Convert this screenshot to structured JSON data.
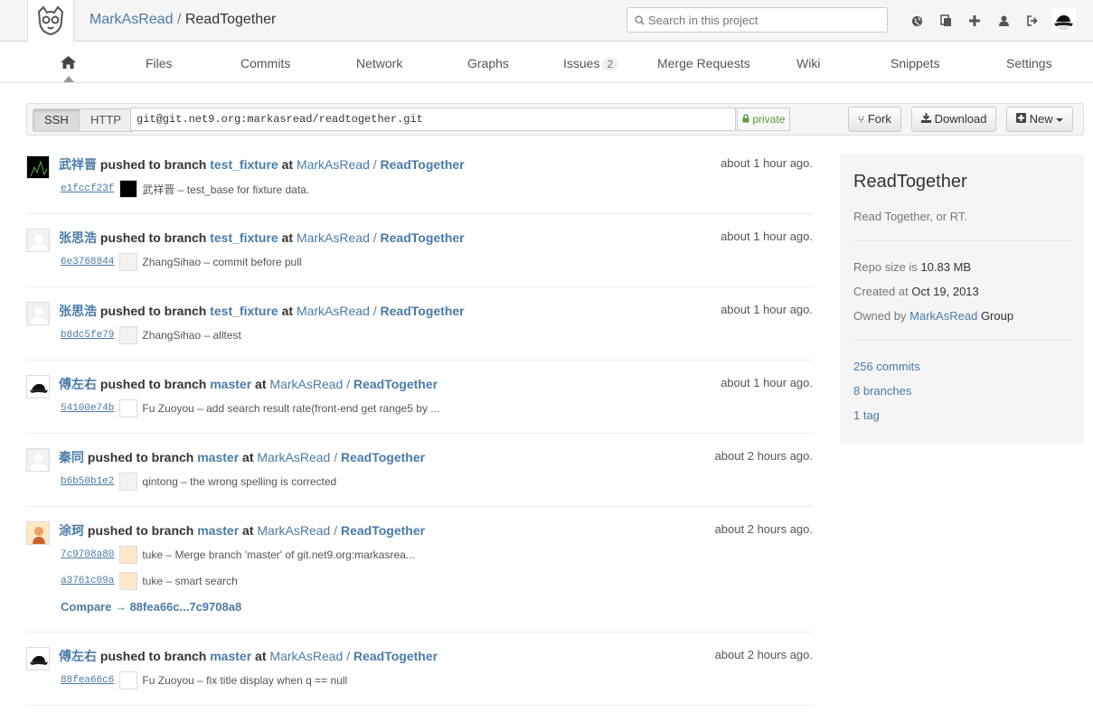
{
  "header": {
    "namespace": "MarkAsRead",
    "separator": "/",
    "project": "ReadTogether",
    "search_placeholder": "Search in this project"
  },
  "nav": {
    "tabs": [
      {
        "label": "Files"
      },
      {
        "label": "Commits"
      },
      {
        "label": "Network"
      },
      {
        "label": "Graphs"
      },
      {
        "label": "Issues",
        "count": "2"
      },
      {
        "label": "Merge Requests"
      },
      {
        "label": "Wiki"
      },
      {
        "label": "Snippets"
      },
      {
        "label": "Settings"
      }
    ]
  },
  "clone": {
    "ssh_label": "SSH",
    "http_label": "HTTP",
    "url": "git@git.net9.org:markasread/readtogether.git",
    "visibility": "private",
    "fork_label": "Fork",
    "download_label": "Download",
    "new_label": "New"
  },
  "events": [
    {
      "user": "武祥晋",
      "action": "pushed to branch",
      "branch": "test_fixture",
      "at": "at",
      "namespace": "MarkAsRead",
      "project": "ReadTogether",
      "time": "about 1 hour ago.",
      "commits": [
        {
          "sha": "e1fccf23f",
          "message": "武祥晋 – test_base for fixture data."
        }
      ]
    },
    {
      "user": "张思浩",
      "action": "pushed to branch",
      "branch": "test_fixture",
      "at": "at",
      "namespace": "MarkAsRead",
      "project": "ReadTogether",
      "time": "about 1 hour ago.",
      "commits": [
        {
          "sha": "6e3768844",
          "message": "ZhangSihao – commit before pull"
        }
      ]
    },
    {
      "user": "张思浩",
      "action": "pushed to branch",
      "branch": "test_fixture",
      "at": "at",
      "namespace": "MarkAsRead",
      "project": "ReadTogether",
      "time": "about 1 hour ago.",
      "commits": [
        {
          "sha": "b8dc5fe79",
          "message": "ZhangSihao – alltest"
        }
      ]
    },
    {
      "user": "傅左右",
      "action": "pushed to branch",
      "branch": "master",
      "at": "at",
      "namespace": "MarkAsRead",
      "project": "ReadTogether",
      "time": "about 1 hour ago.",
      "commits": [
        {
          "sha": "54100e74b",
          "message": "Fu Zuoyou – add search result rate(front-end get range5 by ..."
        }
      ]
    },
    {
      "user": "秦同",
      "action": "pushed to branch",
      "branch": "master",
      "at": "at",
      "namespace": "MarkAsRead",
      "project": "ReadTogether",
      "time": "about 2 hours ago.",
      "commits": [
        {
          "sha": "b6b50b1e2",
          "message": "qintong – the wrong spelling is corrected"
        }
      ]
    },
    {
      "user": "涂珂",
      "action": "pushed to branch",
      "branch": "master",
      "at": "at",
      "namespace": "MarkAsRead",
      "project": "ReadTogether",
      "time": "about 2 hours ago.",
      "commits": [
        {
          "sha": "7c9708a80",
          "message": "tuke – Merge branch 'master' of git.net9.org:markasrea..."
        },
        {
          "sha": "a3761c09a",
          "message": "tuke – smart search"
        }
      ],
      "compare": "Compare → 88fea66c...7c9708a8"
    },
    {
      "user": "傅左右",
      "action": "pushed to branch",
      "branch": "master",
      "at": "at",
      "namespace": "MarkAsRead",
      "project": "ReadTogether",
      "time": "about 2 hours ago.",
      "commits": [
        {
          "sha": "88fea66c6",
          "message": "Fu Zuoyou – fix title display when q == null"
        }
      ]
    }
  ],
  "sidebar": {
    "title": "ReadTogether",
    "description": "Read Together, or RT.",
    "repo_size_label": "Repo size is",
    "repo_size": "10.83 MB",
    "created_label": "Created at",
    "created": "Oct 19, 2013",
    "owned_label": "Owned by",
    "owner": "MarkAsRead",
    "owner_suffix": "Group",
    "commits_link": "256 commits",
    "branches_link": "8 branches",
    "tags_link": "1 tag"
  },
  "colors": {
    "link": "#4a7ba7",
    "private": "#5a9a3a"
  }
}
